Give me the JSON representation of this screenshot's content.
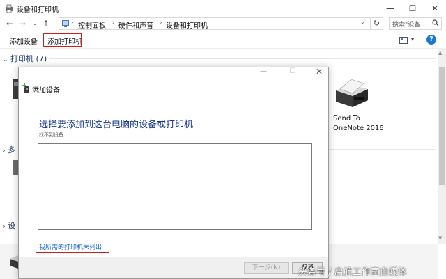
{
  "window": {
    "title": "设备和打印机",
    "controls": {
      "minimize": "—",
      "maximize": "☐",
      "close": "✕"
    }
  },
  "address": {
    "crumbs": [
      "控制面板",
      "硬件和声音",
      "设备和打印机"
    ],
    "search_placeholder": "搜索\"设备..."
  },
  "toolbar": {
    "add_device": "添加设备",
    "add_printer": "添加打印机"
  },
  "sections": {
    "printers": "打印机 (7)",
    "multimedia_partial": "多",
    "devices_partial": "设"
  },
  "devices": [
    {
      "label_line1": "Send To",
      "label_line2": "OneNote 2016"
    }
  ],
  "dialog": {
    "title": "添加设备",
    "heading": "选择要添加到这台电脑的设备或打印机",
    "subtext": "找不到设备",
    "link": "我所需的打印机未列出",
    "next_button": "下一步(N)",
    "cancel_button": "取消"
  },
  "watermark": "头条号 / 启航工作室自媒体",
  "colors": {
    "highlight": "#d11c1c",
    "heading": "#1a3a8f",
    "link": "#1565c0"
  }
}
